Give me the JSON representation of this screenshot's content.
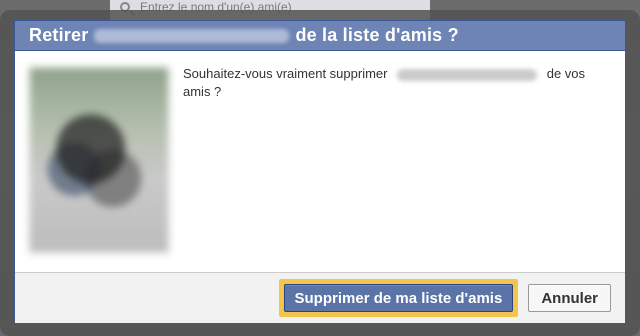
{
  "background": {
    "search_placeholder": "Entrez le nom d'un(e) ami(e)"
  },
  "dialog": {
    "title_prefix": "Retirer",
    "title_suffix": "de la liste d'amis ?",
    "message_prefix": "Souhaitez-vous vraiment supprimer",
    "message_suffix": "de vos",
    "message_line2": "amis ?"
  },
  "buttons": {
    "primary_label": "Supprimer de ma liste d'amis",
    "secondary_label": "Annuler"
  },
  "colors": {
    "header_bg": "#6d84b4",
    "primary_button_bg": "#5b74a8",
    "focus_ring": "#f4c54c"
  }
}
